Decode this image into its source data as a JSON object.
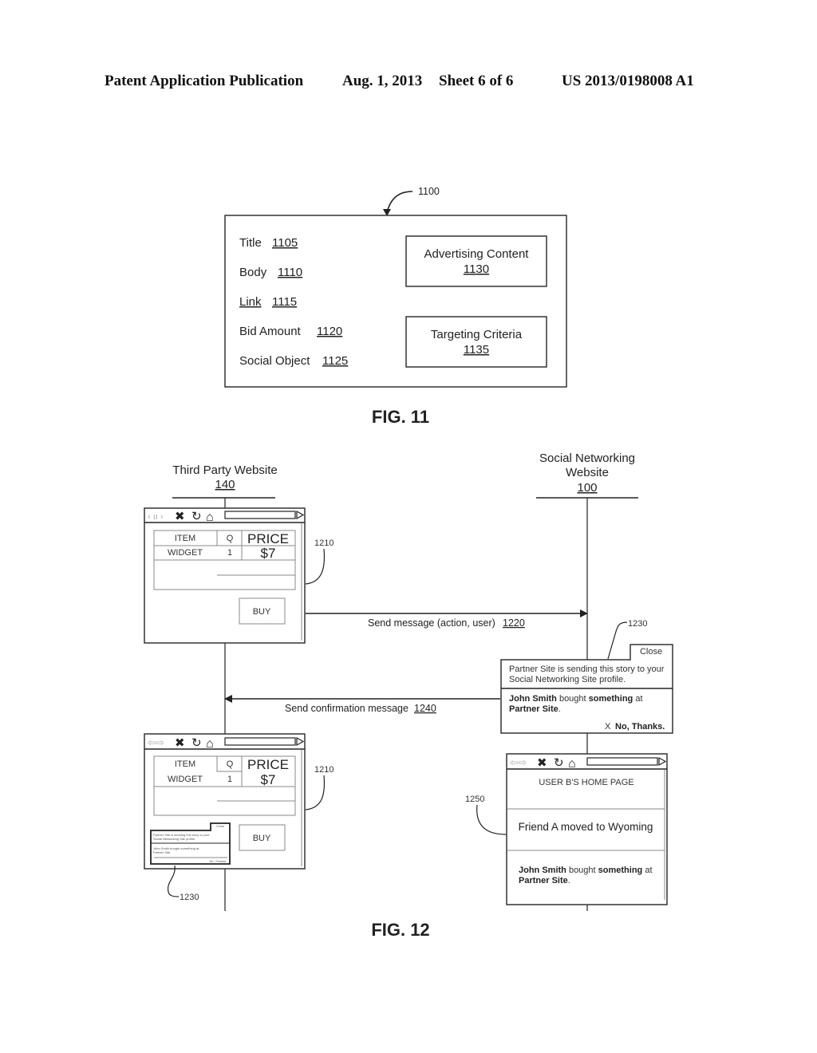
{
  "header": {
    "publication": "Patent Application Publication",
    "date": "Aug. 1, 2013",
    "sheet": "Sheet 6 of 6",
    "patent_number": "US 2013/0198008 A1"
  },
  "fig11": {
    "ref": "1100",
    "fields": [
      {
        "label": "Title",
        "ref": "1105"
      },
      {
        "label": "Body",
        "ref": "1110"
      },
      {
        "label": "Link",
        "ref": "1115"
      },
      {
        "label": "Bid Amount",
        "ref": "1120"
      },
      {
        "label": "Social Object",
        "ref": "1125"
      }
    ],
    "boxes": [
      {
        "label": "Advertising Content",
        "ref": "1130"
      },
      {
        "label": "Targeting Criteria",
        "ref": "1135"
      }
    ],
    "caption": "FIG. 11"
  },
  "fig12": {
    "third_party": {
      "label": "Third Party Website",
      "ref": "140"
    },
    "social": {
      "label_line1": "Social Networking",
      "label_line2": "Website",
      "ref": "100"
    },
    "browser_ref": "1210",
    "table": {
      "headers": [
        "ITEM",
        "Q",
        "PRICE"
      ],
      "row": [
        "WIDGET",
        "1",
        "$7"
      ]
    },
    "buy_label": "BUY",
    "send_message": {
      "label": "Send message (action, user)",
      "ref": "1220"
    },
    "confirmation": {
      "label": "Send confirmation message",
      "ref": "1240"
    },
    "dialog": {
      "ref": "1230",
      "close": "Close",
      "line1": "Partner Site is sending this story to your",
      "line2": "Social Networking Site profile.",
      "story_name": "John Smith",
      "story_mid": " bought ",
      "story_obj": "something",
      "story_at": " at",
      "story_site": "Partner Site",
      "story_end": ".",
      "decline_x": "X",
      "decline": "No, Thanks."
    },
    "home_page": {
      "ref": "1250",
      "title": "USER B'S HOME PAGE",
      "item1": "Friend A moved to Wyoming"
    },
    "caption": "FIG. 12"
  }
}
